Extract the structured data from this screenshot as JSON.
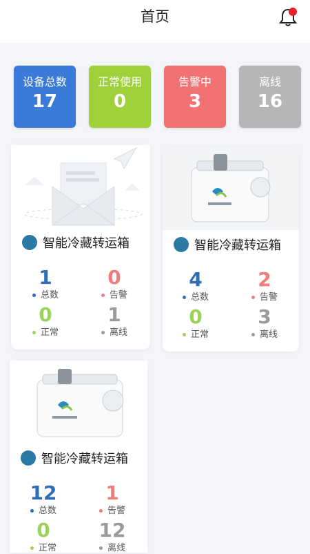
{
  "header": {
    "title": "首页"
  },
  "stats": [
    {
      "label": "设备总数",
      "value": "17",
      "color": "#3a7ad9"
    },
    {
      "label": "正常使用",
      "value": "0",
      "color": "#9fd13b"
    },
    {
      "label": "告警中",
      "value": "3",
      "color": "#f07272"
    },
    {
      "label": "离线",
      "value": "16",
      "color": "#b6b6b6"
    }
  ],
  "cards": [
    {
      "name": "智能冷藏转运箱",
      "image": "envelope-placeholder",
      "total": "1",
      "alarm": "0",
      "normal": "0",
      "offline": "1",
      "total_label": "总数",
      "alarm_label": "告警",
      "normal_label": "正常",
      "offline_label": "离线"
    },
    {
      "name": "智能冷藏转运箱",
      "image": "cold-box-device",
      "total": "4",
      "alarm": "2",
      "normal": "0",
      "offline": "3",
      "total_label": "总数",
      "alarm_label": "告警",
      "normal_label": "正常",
      "offline_label": "离线"
    },
    {
      "name": "智能冷藏转运箱",
      "image": "cold-box-device",
      "total": "12",
      "alarm": "1",
      "normal": "0",
      "offline": "12",
      "total_label": "总数",
      "alarm_label": "告警",
      "normal_label": "正常",
      "offline_label": "离线"
    }
  ],
  "colors": {
    "accent_blue": "#2f6db6",
    "alarm_red": "#f07d7d",
    "ok_green": "#9ad25a",
    "offline_grey": "#9a9a9a"
  }
}
